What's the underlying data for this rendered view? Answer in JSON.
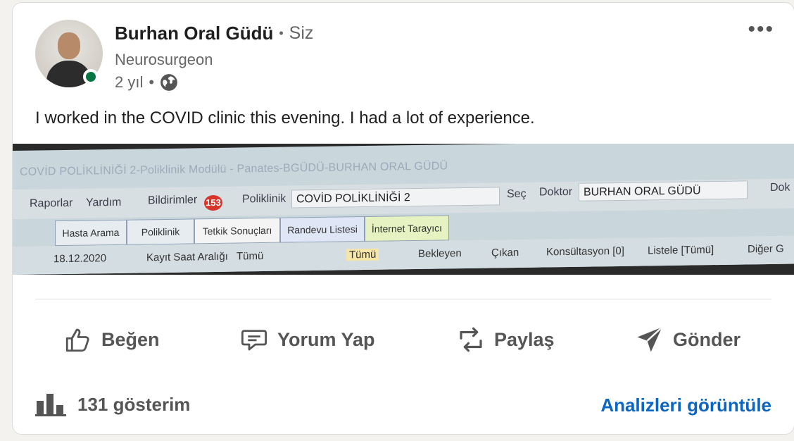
{
  "author": {
    "name": "Burhan Oral Güdü",
    "relation": "Siz",
    "separator": "•",
    "title": "Neurosurgeon",
    "time": "2 yıl",
    "time_separator": "•",
    "visibility_icon": "globe-icon",
    "online_status_color": "#057642"
  },
  "menu": {
    "more_label": "•••"
  },
  "post": {
    "text": "I worked in the COVID clinic this evening. I had a lot of experience."
  },
  "image": {
    "window_title": "COVİD POLİKLİNİĞİ 2-Poliklinik Modülü - Panates-BGÜDÜ-BURHAN ORAL GÜDÜ",
    "menu": {
      "raporlar": "Raporlar",
      "yardim": "Yardım",
      "bildirimler": "Bildirimler",
      "badge_count": "153",
      "poliklinik_label": "Poliklinik",
      "poliklinik_value": "COVİD POLİKLİNİĞİ 2",
      "sec": "Seç",
      "doktor_label": "Doktor",
      "doktor_value": "BURHAN ORAL GÜDÜ",
      "next": "Dok"
    },
    "tabs": [
      "Hasta Arama",
      "Poliklinik",
      "Tetkik Sonuçları",
      "Randevu Listesi",
      "İnternet Tarayıcı"
    ],
    "toolbar": {
      "date": "18.12.2020",
      "kayit": "Kayıt Saat Aralığı",
      "kayit_value": "Tümü",
      "tumu": "Tümü",
      "bekleyen": "Bekleyen",
      "cikan": "Çıkan",
      "konsultasyon": "Konsültasyon [0]",
      "listele": "Listele [Tümü]",
      "diger": "Diğer G"
    }
  },
  "actions": {
    "like": "Beğen",
    "comment": "Yorum Yap",
    "share": "Paylaş",
    "send": "Gönder"
  },
  "stats": {
    "views": "131 gösterim",
    "analytics_link": "Analizleri görüntüle",
    "link_color": "#0a66c2"
  }
}
